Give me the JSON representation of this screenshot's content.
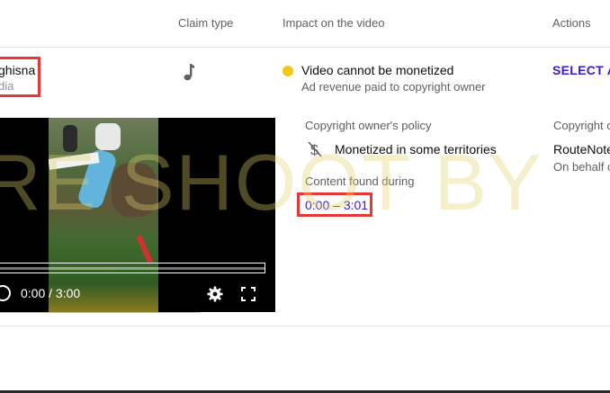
{
  "columns": {
    "claim_type": "Claim type",
    "impact": "Impact on the video",
    "actions": "Actions"
  },
  "claim": {
    "title_fragment": "ghisna",
    "subtitle_fragment": "dia",
    "claim_type_icon": "music-note-icon",
    "impact_status": "Video cannot be monetized",
    "impact_detail": "Ad revenue paid to copyright owner",
    "status_color": "#f2c811",
    "action_label": "SELECT A"
  },
  "policy": {
    "heading": "Copyright owner's policy",
    "icon": "no-dollar-icon",
    "value": "Monetized in some territories",
    "content_found_heading": "Content found during",
    "content_found_range": "0:00 – 3:01"
  },
  "owner": {
    "heading": "Copyright o",
    "name": "RouteNote",
    "on_behalf": "On behalf o"
  },
  "player": {
    "time": "0:00 / 3:00",
    "progress": 0.0
  },
  "watermark": "RE SHOOT BY",
  "colors": {
    "link": "#3a19d6",
    "highlight": "#e53935"
  }
}
